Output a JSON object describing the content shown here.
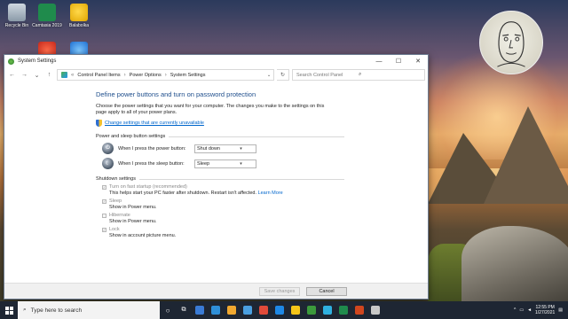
{
  "desktop": {
    "icons": [
      {
        "label": "Recycle Bin"
      },
      {
        "label": "Camtasia 2019"
      },
      {
        "label": "Balabolka"
      },
      {
        "label": ""
      },
      {
        "label": ""
      }
    ]
  },
  "window": {
    "title": "System Settings",
    "controls": {
      "minimize": "—",
      "maximize": "☐",
      "close": "✕"
    },
    "address": {
      "crumbs": [
        "Control Panel Items",
        "Power Options",
        "System Settings"
      ],
      "root_glyph": "«"
    },
    "search_placeholder": "Search Control Panel",
    "heading": "Define power buttons and turn on password protection",
    "intro": "Choose the power settings that you want for your computer. The changes you make to the settings on this page apply to all of your power plans.",
    "change_link": "Change settings that are currently unavailable",
    "power_section": {
      "title": "Power and sleep button settings",
      "rows": [
        {
          "label": "When I press the power button:",
          "value": "Shut down"
        },
        {
          "label": "When I press the sleep button:",
          "value": "Sleep"
        }
      ]
    },
    "shutdown_section": {
      "title": "Shutdown settings",
      "items": [
        {
          "label": "Turn on fast startup (recommended)",
          "checked": true,
          "desc": "This helps start your PC faster after shutdown. Restart isn't affected.",
          "link": "Learn More"
        },
        {
          "label": "Sleep",
          "checked": true,
          "desc": "Show in Power menu."
        },
        {
          "label": "Hibernate",
          "checked": false,
          "desc": "Show in Power menu."
        },
        {
          "label": "Lock",
          "checked": true,
          "desc": "Show in account picture menu."
        }
      ]
    },
    "buttons": {
      "save": "Save changes",
      "cancel": "Cancel"
    }
  },
  "taskbar": {
    "search_placeholder": "Type here to search",
    "time": "12:55 PM",
    "date": "1/27/2021",
    "app_colors": [
      "#3a7bd5",
      "#2f8fd8",
      "#f0a830",
      "#4a9fe0",
      "#e04a3a",
      "#1e88e5",
      "#f5c518",
      "#3c9a3c",
      "#2fb0e0",
      "#1f8b4c",
      "#d0461e",
      "#c8c8c8"
    ]
  }
}
